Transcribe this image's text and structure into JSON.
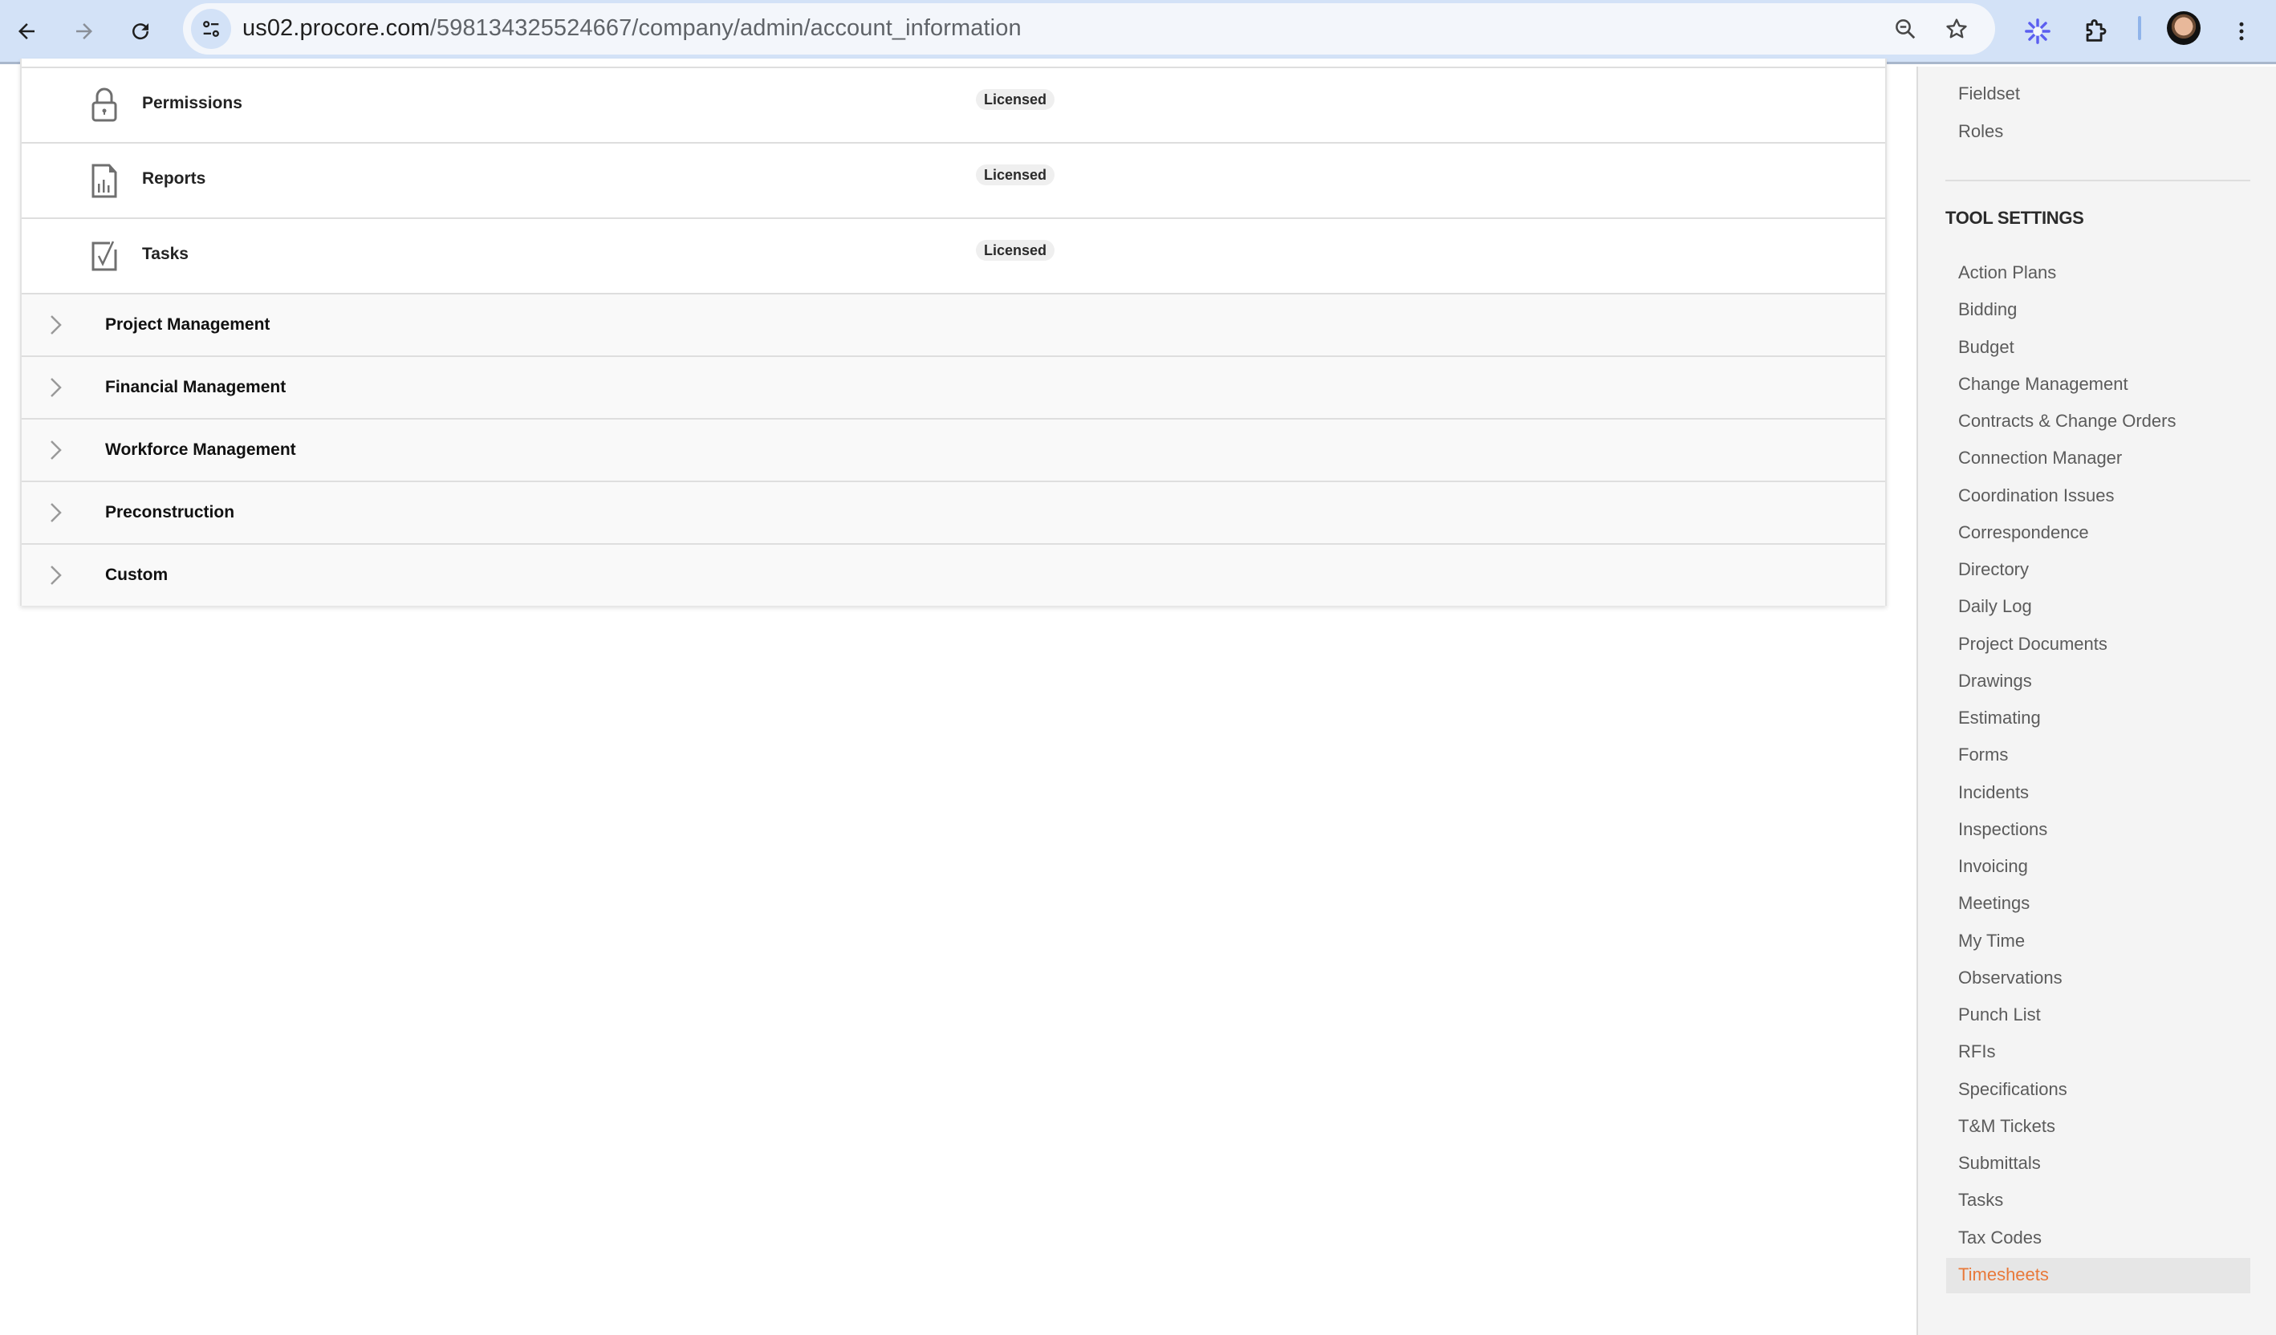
{
  "browser": {
    "url_host": "us02.procore.com",
    "url_path": "/598134325524667/company/admin/account_information",
    "icons": {
      "back": "arrow-left-icon",
      "forward": "arrow-right-icon",
      "reload": "reload-icon",
      "site_info": "tune-icon",
      "zoom": "zoom-out-icon",
      "bookmark": "star-icon",
      "extension_claude": "sparkle-icon",
      "extensions": "puzzle-icon",
      "profile": "avatar",
      "menu": "more-vert-icon"
    },
    "colors": {
      "toolbar_bg": "#d3e2f7",
      "url_bg": "#f3f6fb",
      "sparkle": "#5b5ef0"
    }
  },
  "main": {
    "tools": [
      {
        "name": "Permissions",
        "icon": "lock-icon",
        "status": "Licensed"
      },
      {
        "name": "Reports",
        "icon": "report-icon",
        "status": "Licensed"
      },
      {
        "name": "Tasks",
        "icon": "checkbox-icon",
        "status": "Licensed"
      }
    ],
    "groups": [
      {
        "name": "Project Management",
        "expanded": false
      },
      {
        "name": "Financial Management",
        "expanded": false
      },
      {
        "name": "Workforce Management",
        "expanded": false
      },
      {
        "name": "Preconstruction",
        "expanded": false
      },
      {
        "name": "Custom",
        "expanded": false
      }
    ]
  },
  "sidebar": {
    "top_links": [
      "Fieldset",
      "Roles"
    ],
    "section_heading": "TOOL SETTINGS",
    "tool_links": [
      "Action Plans",
      "Bidding",
      "Budget",
      "Change Management",
      "Contracts & Change Orders",
      "Connection Manager",
      "Coordination Issues",
      "Correspondence",
      "Directory",
      "Daily Log",
      "Project Documents",
      "Drawings",
      "Estimating",
      "Forms",
      "Incidents",
      "Inspections",
      "Invoicing",
      "Meetings",
      "My Time",
      "Observations",
      "Punch List",
      "RFIs",
      "Specifications",
      "T&M Tickets",
      "Submittals",
      "Tasks",
      "Tax Codes",
      "Timesheets"
    ],
    "active_link": "Timesheets",
    "colors": {
      "active_text": "#e8793a",
      "active_bg": "#e6e6e6",
      "link_text": "#5b5b5b"
    }
  }
}
